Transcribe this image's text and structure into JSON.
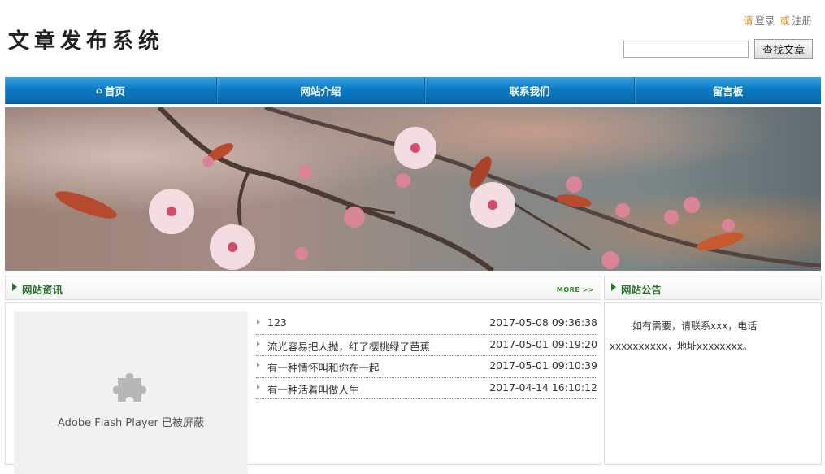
{
  "header": {
    "logo": "文章发布系统",
    "auth": {
      "prefix": "请",
      "login": "登录",
      "or": "或",
      "register": "注册"
    },
    "search": {
      "value": "",
      "button_label": "查找文章"
    }
  },
  "nav": {
    "items": [
      {
        "label": "首页",
        "icon": "home-icon"
      },
      {
        "label": "网站介绍"
      },
      {
        "label": "联系我们"
      },
      {
        "label": "留言板"
      }
    ]
  },
  "news": {
    "title": "网站资讯",
    "more_label": "MORE >>",
    "flash_text": "Adobe Flash Player 已被屏蔽",
    "items": [
      {
        "title": "123",
        "time": "2017-05-08 09:36:38"
      },
      {
        "title": "流光容易把人抛，红了樱桃绿了芭蕉",
        "time": "2017-05-01 09:19:20"
      },
      {
        "title": "有一种情怀叫和你在一起",
        "time": "2017-05-01 09:10:39"
      },
      {
        "title": "有一种活着叫做人生",
        "time": "2017-04-14 16:10:12"
      }
    ]
  },
  "notice": {
    "title": "网站公告",
    "text": "如有需要，请联系xxx，电话xxxxxxxxxx，地址xxxxxxxx。"
  },
  "colors": {
    "nav_blue": "#0b7bc4",
    "accent_orange": "#e08a16",
    "section_green": "#2c6e2c"
  }
}
